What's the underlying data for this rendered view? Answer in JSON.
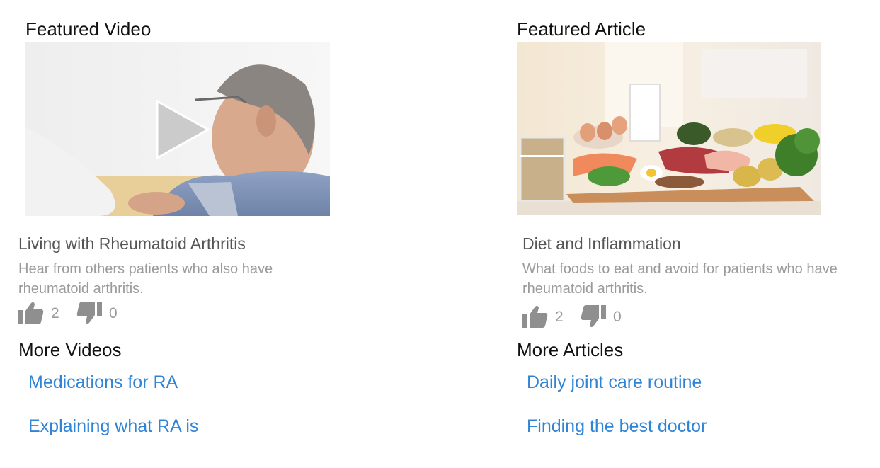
{
  "video": {
    "section_heading": "Featured Video",
    "title": "Living with Rheumatoid Arthritis",
    "description": "Hear from others patients who also have rheumatoid arthritis.",
    "likes": "2",
    "dislikes": "0",
    "more_heading": "More Videos",
    "more_links": [
      "Medications for RA",
      "Explaining what RA is"
    ]
  },
  "article": {
    "section_heading": "Featured Article",
    "title": "Diet and Inflammation",
    "description": "What foods to eat and avoid for patients who have rheumatoid arthritis.",
    "likes": "2",
    "dislikes": "0",
    "more_heading": "More Articles",
    "more_links": [
      "Daily joint care routine",
      "Finding the best doctor"
    ]
  },
  "colors": {
    "link": "#2f84d6",
    "heading": "#111111",
    "title": "#555555",
    "muted": "#9a9a9a"
  },
  "icons": [
    "play-icon",
    "thumbs-up-icon",
    "thumbs-down-icon"
  ]
}
